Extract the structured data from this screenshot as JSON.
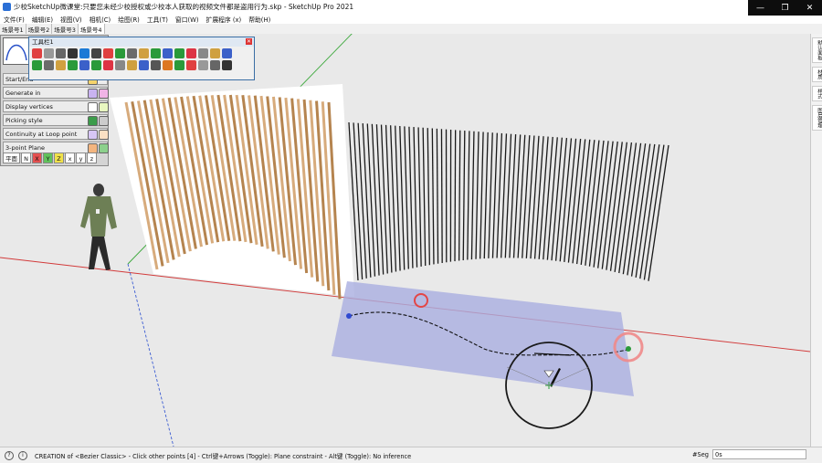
{
  "window": {
    "title": "少校SketchUp微课堂:只要您未经少校授权或少校本人获取的视频文件都是盗用行为.skp - SketchUp Pro 2021",
    "controls": [
      "—",
      "❐",
      "✕"
    ]
  },
  "menu": [
    "文件(F)",
    "编辑(E)",
    "视图(V)",
    "相机(C)",
    "绘图(R)",
    "工具(T)",
    "窗口(W)",
    "扩展程序 (x)",
    "帮助(H)"
  ],
  "scenes": [
    "场景号1",
    "场景号2",
    "场景号3",
    "场景号4"
  ],
  "active_scene_index": 3,
  "toolbar1": {
    "title": "工具栏1",
    "close": "✕"
  },
  "bezier_panel": {
    "rows": [
      "Start/End",
      "Generate in",
      "Display vertices",
      "Picking style",
      "Continuity at Loop point",
      "3-point Plane"
    ],
    "axes": [
      "平面",
      "N",
      "X",
      "Y",
      "Z",
      "x",
      "y",
      "z"
    ]
  },
  "status": {
    "text": "CREATION of <Bezier Classic> - Click other points [4] - Ctrl键+Arrows (Toggle): Plane constraint - Alt键 (Toggle): No inference",
    "measure_label": "#Seg",
    "measure_value": "0s"
  },
  "right_panel": [
    "默认面板",
    "材质",
    "样式",
    "图层管理"
  ],
  "colors": {
    "axis_red": "#d23a3a",
    "axis_green": "#3aa83a",
    "axis_blue": "#3a5bd2",
    "plane": "#a9aee0",
    "wood": "#c79a6a"
  }
}
